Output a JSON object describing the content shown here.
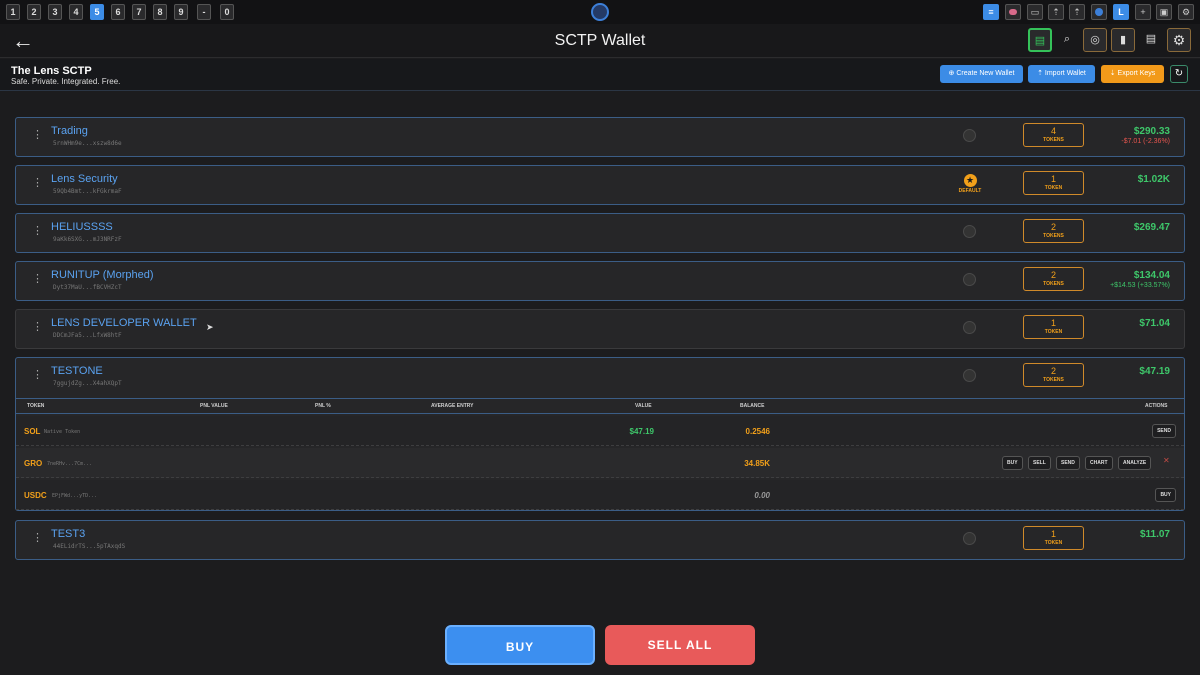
{
  "workspaces": [
    "1",
    "2",
    "3",
    "4",
    "5",
    "6",
    "7",
    "8",
    "9",
    "-",
    "0"
  ],
  "active_workspace": "5",
  "tray_icons": [
    "list-icon",
    "brain-icon",
    "chat-icon",
    "upload-icon",
    "upload-icon",
    "globe-icon",
    "L",
    "+",
    "square-icon",
    "gear-icon"
  ],
  "tray_labels": {
    "L": "L",
    "plus": "+"
  },
  "header": {
    "back": "←",
    "title": "SCTP Wallet"
  },
  "brand": {
    "name": "The Lens SCTP",
    "tagline": "Safe. Private. Integrated. Free."
  },
  "actions": {
    "create": "Create New Wallet",
    "import": "Import Wallet",
    "export": "Export Keys"
  },
  "wallets": [
    {
      "name": "Trading",
      "address": "5rnWHm9e...xszw8d6e",
      "tokens": "4",
      "token_label": "TOKENS",
      "usd": "$290.33",
      "pnl": "-$7.01 (-2.36%)",
      "default": false
    },
    {
      "name": "Lens Security",
      "address": "59Qb4Bmt...kFGkrmaF",
      "tokens": "1",
      "token_label": "TOKEN",
      "usd": "$1.02K",
      "pnl": "",
      "default": true,
      "default_label": "DEFAULT"
    },
    {
      "name": "HELIUSSSS",
      "address": "9aKk6SXG...mJ3NRFzF",
      "tokens": "2",
      "token_label": "TOKENS",
      "usd": "$269.47",
      "pnl": "",
      "default": false
    },
    {
      "name": "RUNITUP (Morphed)",
      "address": "Dyt37MaU...fBCVHZcT",
      "tokens": "2",
      "token_label": "TOKENS",
      "usd": "$134.04",
      "pnl": "+$14.53 (+33.57%)",
      "default": false
    },
    {
      "name": "LENS DEVELOPER WALLET",
      "address": "DDCmJFa5...LfxW8htF",
      "tokens": "1",
      "token_label": "TOKEN",
      "usd": "$71.04",
      "pnl": "",
      "default": false
    },
    {
      "name": "TESTONE",
      "address": "7ggujdZg...X4ahXQpT",
      "tokens": "2",
      "token_label": "TOKENS",
      "usd": "$47.19",
      "pnl": "",
      "default": false
    },
    {
      "name": "TEST3",
      "address": "44ELidrTS...5pTAxqdS",
      "tokens": "1",
      "token_label": "TOKEN",
      "usd": "$11.07",
      "pnl": "",
      "default": false
    }
  ],
  "token_table": {
    "headers": [
      "TOKEN",
      "PNL VALUE",
      "PNL %",
      "AVERAGE ENTRY",
      "VALUE",
      "BALANCE",
      "ACTIONS"
    ],
    "rows": [
      {
        "symbol": "SOL",
        "sub": "Native Token",
        "value": "$47.19",
        "balance": "0.2546",
        "actions": [
          "SEND"
        ]
      },
      {
        "symbol": "GRO",
        "sub": "7neRHv...7Cm...",
        "value": "",
        "balance": "34.85K",
        "actions": [
          "BUY",
          "SELL",
          "SEND",
          "CHART",
          "ANALYZE"
        ],
        "remove": "✕"
      },
      {
        "symbol": "USDC",
        "sub": "EPjFWd...yTD...",
        "value": "0.00",
        "balance": "",
        "actions": [
          "BUY"
        ]
      }
    ]
  },
  "footer": {
    "buy": "BUY",
    "sell_all": "SELL ALL"
  },
  "colors": {
    "accent_blue": "#3c8ce6",
    "green": "#3ec76a",
    "red": "#e4554e",
    "orange": "#f2a01a"
  }
}
